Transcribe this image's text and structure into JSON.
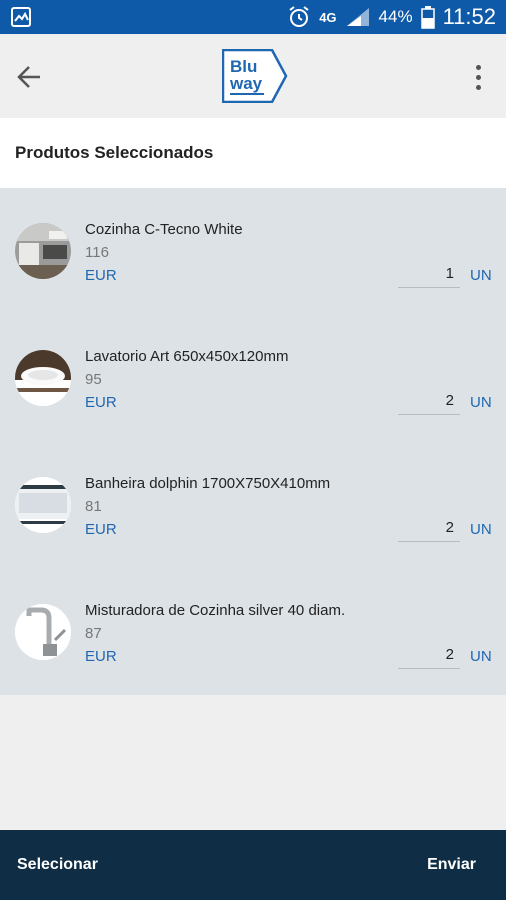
{
  "status_bar": {
    "network": "4G",
    "battery": "44%",
    "time": "11:52"
  },
  "app_bar": {
    "logo_line1": "Blu",
    "logo_line2": "way"
  },
  "section": {
    "title": "Produtos Seleccionados"
  },
  "products": [
    {
      "name": "Cozinha C-Tecno White",
      "code": "116",
      "currency": "EUR",
      "quantity": "1",
      "unit": "UN"
    },
    {
      "name": "Lavatorio Art 650x450x120mm",
      "code": "95",
      "currency": "EUR",
      "quantity": "2",
      "unit": "UN"
    },
    {
      "name": "Banheira dolphin 1700X750X410mm",
      "code": "81",
      "currency": "EUR",
      "quantity": "2",
      "unit": "UN"
    },
    {
      "name": "Misturadora de Cozinha silver 40 diam.",
      "code": "87",
      "currency": "EUR",
      "quantity": "2",
      "unit": "UN"
    }
  ],
  "bottom_bar": {
    "select_label": "Selecionar",
    "send_label": "Enviar"
  },
  "colors": {
    "status_bar": "#0f5aa8",
    "accent": "#1f67b0",
    "list_bg": "#dde2e6",
    "bottom_bar": "#0f2e45"
  }
}
